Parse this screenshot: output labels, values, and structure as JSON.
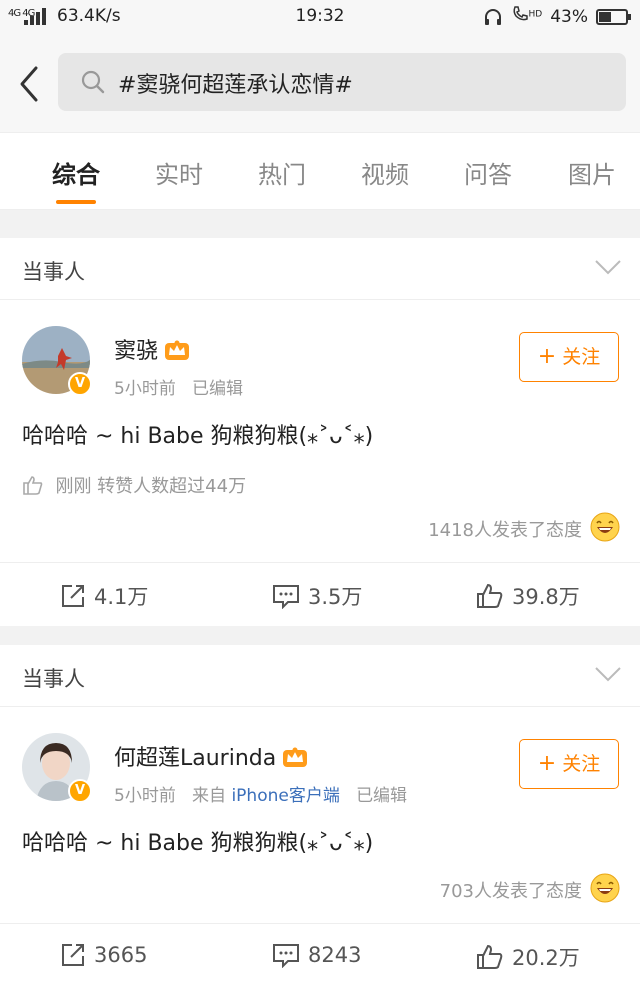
{
  "status": {
    "network": "4G 4G",
    "speed": "63.4K/s",
    "time": "19:32",
    "hd": "HD",
    "battery": "43%"
  },
  "search": {
    "query": "#窦骁何超莲承认恋情#"
  },
  "tabs": [
    {
      "label": "综合",
      "active": true
    },
    {
      "label": "实时"
    },
    {
      "label": "热门"
    },
    {
      "label": "视频"
    },
    {
      "label": "问答"
    },
    {
      "label": "图片"
    }
  ],
  "accent": "#ff8200",
  "posts": [
    {
      "section": "当事人",
      "user": "窦骁",
      "time": "5小时前",
      "edited": "已编辑",
      "follow": "关注",
      "text": "哈哈哈 ~ hi Babe 狗粮狗粮(⁎˃ᴗ˂⁎)",
      "forward_info": "刚刚 转赞人数超过44万",
      "reactions": "1418人发表了态度",
      "reposts": "4.1万",
      "comments": "3.5万",
      "likes": "39.8万"
    },
    {
      "section": "当事人",
      "user": "何超莲Laurinda",
      "time": "5小时前",
      "from": "来自",
      "client": "iPhone客户端",
      "edited": "已编辑",
      "follow": "关注",
      "text": "哈哈哈 ~ hi Babe 狗粮狗粮(⁎˃ᴗ˂⁎)",
      "reactions": "703人发表了态度",
      "reposts": "3665",
      "comments": "8243",
      "likes": "20.2万"
    }
  ]
}
